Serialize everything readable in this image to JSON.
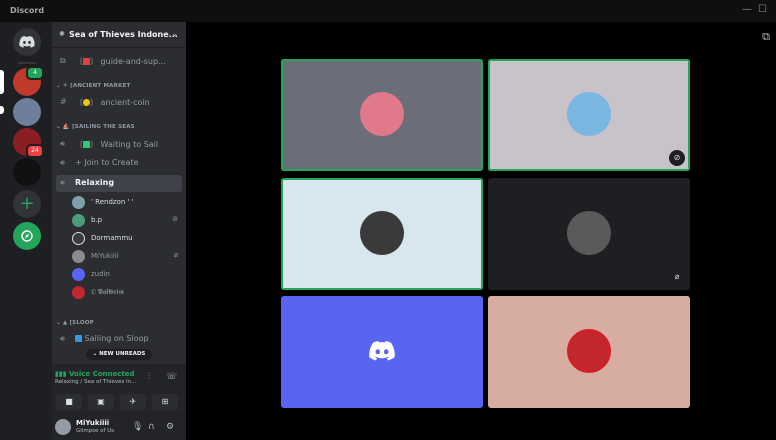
{
  "window": {
    "title": "Discord",
    "minimize": "—",
    "maximize": "☐"
  },
  "server": {
    "name": "Sea of Thieves Indone...",
    "channel_top": "guide-and-sup..."
  },
  "categories": {
    "market": "[ANCIENT MARKET",
    "seas": "[SAILING THE SEAS",
    "sloop": "[SLOOP"
  },
  "channels": {
    "ancient_coin": "ancient-coin",
    "waiting": "Waiting to Sail",
    "join": "Join to Create",
    "relaxing": "Relaxing",
    "sloop": "Sailing on Sloop"
  },
  "members": [
    {
      "name": "' Rendzon ' '",
      "color": "#8aa"
    },
    {
      "name": "b.p",
      "color": "#5b8"
    },
    {
      "name": "Dormammu",
      "color": "#888"
    },
    {
      "name": "MiYukiiii",
      "color": "#999"
    },
    {
      "name": "zudin",
      "color": "#5865f2"
    },
    {
      "name": "𝕺 𝖁𝖆𝖑𝕲𝖗𝖎𝖒",
      "color": "#c33"
    }
  ],
  "new_unreads": "NEW UNREADS",
  "voice": {
    "status": "Voice Connected",
    "location": "Relaxing / Sea of Thieves In..."
  },
  "user": {
    "name": "MiYukiiii",
    "status": "Glimpse of Us"
  },
  "rail_badges": {
    "server_1": "4",
    "server_4": "24"
  },
  "tiles": [
    {
      "name": "tile-member-1",
      "bg": "#6b6e78",
      "avatar": "#e07a8a",
      "speaking": true
    },
    {
      "name": "tile-member-2",
      "bg": "#c7c3c8",
      "avatar": "#7ab7e0",
      "speaking": true,
      "muted": true
    },
    {
      "name": "tile-member-3",
      "bg": "#d8e6ee",
      "avatar": "#3a3a3a",
      "speaking": true
    },
    {
      "name": "tile-member-4",
      "bg": "#1e1f22",
      "avatar": "#5a5a5a",
      "speaking": false,
      "muted": true
    },
    {
      "name": "tile-member-5",
      "bg": "#5865f2",
      "avatar": "#5865f2",
      "speaking": false
    },
    {
      "name": "tile-member-6",
      "bg": "#d6ada0",
      "avatar": "#c1272d",
      "speaking": false
    }
  ]
}
